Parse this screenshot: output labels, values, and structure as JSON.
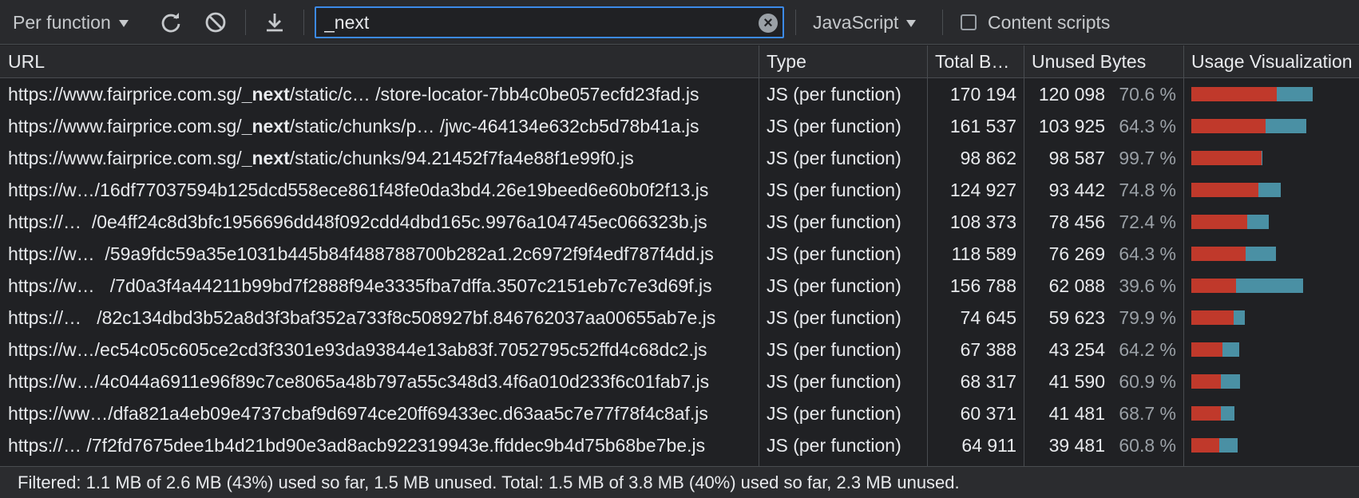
{
  "toolbar": {
    "coverage_mode": "Per function",
    "reload_icon": "reload-icon",
    "clear_icon": "clear-icon",
    "export_icon": "download-icon",
    "filter_value": "_next",
    "filter_clear": "×",
    "type_filter": "JavaScript",
    "content_scripts_label": "Content scripts",
    "content_scripts_checked": false
  },
  "table": {
    "headers": {
      "url": "URL",
      "type": "Type",
      "total": "Total B…",
      "unused": "Unused Bytes",
      "viz": "Usage Visualization"
    },
    "rows": [
      {
        "url_pre": "https://www.fairprice.com.sg/",
        "url_match": "_next",
        "url_post": "/static/c… /store-locator-7bb4c0be057ecfd23fad.js",
        "type": "JS (per function)",
        "total": "170 194",
        "unused": "120 098",
        "pct": "70.6 %"
      },
      {
        "url_pre": "https://www.fairprice.com.sg/",
        "url_match": "_next",
        "url_post": "/static/chunks/p… /jwc-464134e632cb5d78b41a.js",
        "type": "JS (per function)",
        "total": "161 537",
        "unused": "103 925",
        "pct": "64.3 %"
      },
      {
        "url_pre": "https://www.fairprice.com.sg/",
        "url_match": "_next",
        "url_post": "/static/chunks/94.21452f7fa4e88f1e99f0.js",
        "type": "JS (per function)",
        "total": "98 862",
        "unused": "98 587",
        "pct": "99.7 %"
      },
      {
        "url_pre": "https://w…/16df77037594b125dcd558ece861f48fe0da3bd4.26e19beed6e60b0f2f13.js",
        "url_match": "",
        "url_post": "",
        "type": "JS (per function)",
        "total": "124 927",
        "unused": "93 442",
        "pct": "74.8 %"
      },
      {
        "url_pre": "https://…  /0e4ff24c8d3bfc1956696dd48f092cdd4dbd165c.9976a104745ec066323b.js",
        "url_match": "",
        "url_post": "",
        "type": "JS (per function)",
        "total": "108 373",
        "unused": "78 456",
        "pct": "72.4 %"
      },
      {
        "url_pre": "https://w…  /59a9fdc59a35e1031b445b84f488788700b282a1.2c6972f9f4edf787f4dd.js",
        "url_match": "",
        "url_post": "",
        "type": "JS (per function)",
        "total": "118 589",
        "unused": "76 269",
        "pct": "64.3 %"
      },
      {
        "url_pre": "https://w…   /7d0a3f4a44211b99bd7f2888f94e3335fba7dffa.3507c2151eb7c7e3d69f.js",
        "url_match": "",
        "url_post": "",
        "type": "JS (per function)",
        "total": "156 788",
        "unused": "62 088",
        "pct": "39.6 %"
      },
      {
        "url_pre": "https://…   /82c134dbd3b52a8d3f3baf352a733f8c508927bf.846762037aa00655ab7e.js",
        "url_match": "",
        "url_post": "",
        "type": "JS (per function)",
        "total": "74 645",
        "unused": "59 623",
        "pct": "79.9 %"
      },
      {
        "url_pre": "https://w…/ec54c05c605ce2cd3f3301e93da93844e13ab83f.7052795c52ffd4c68dc2.js",
        "url_match": "",
        "url_post": "",
        "type": "JS (per function)",
        "total": "67 388",
        "unused": "43 254",
        "pct": "64.2 %"
      },
      {
        "url_pre": "https://w…/4c044a6911e96f89c7ce8065a48b797a55c348d3.4f6a010d233f6c01fab7.js",
        "url_match": "",
        "url_post": "",
        "type": "JS (per function)",
        "total": "68 317",
        "unused": "41 590",
        "pct": "60.9 %"
      },
      {
        "url_pre": "https://ww…/dfa821a4eb09e4737cbaf9d6974ce20ff69433ec.d63aa5c7e77f78f4c8af.js",
        "url_match": "",
        "url_post": "",
        "type": "JS (per function)",
        "total": "60 371",
        "unused": "41 481",
        "pct": "68.7 %"
      },
      {
        "url_pre": "https://… /7f2fd7675dee1b4d21bd90e3ad8acb922319943e.ffddec9b4d75b68be7be.js",
        "url_match": "",
        "url_post": "",
        "type": "JS (per function)",
        "total": "64 911",
        "unused": "39 481",
        "pct": "60.8 %"
      }
    ]
  },
  "footer": {
    "summary": "Filtered: 1.1 MB of 2.6 MB (43%) used so far, 1.5 MB unused. Total: 1.5 MB of 3.8 MB (40%) used so far, 2.3 MB unused."
  },
  "colors": {
    "unused_bar": "#c0392b",
    "used_bar": "#4a90a4",
    "accent": "#3c8ae8"
  }
}
